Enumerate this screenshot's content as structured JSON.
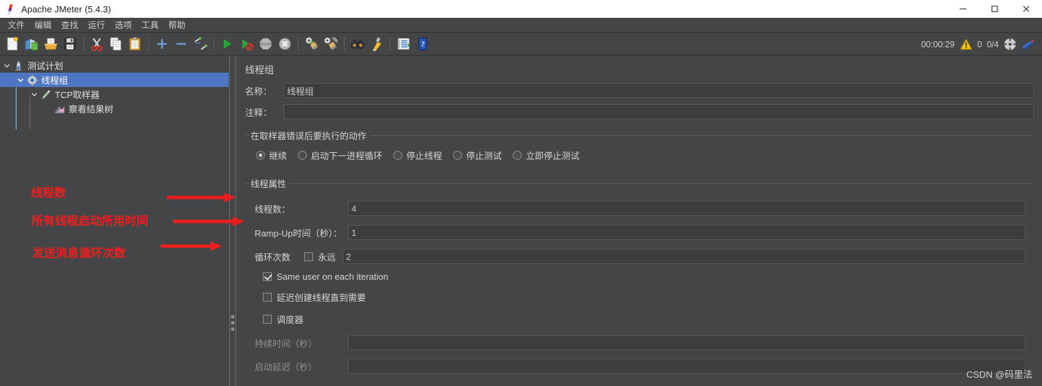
{
  "window": {
    "title": "Apache JMeter (5.4.3)",
    "app_icon": "jmeter-feather-icon",
    "controls": {
      "minimize": "minimize-icon",
      "maximize": "maximize-icon",
      "close": "close-icon"
    }
  },
  "menubar": {
    "items": [
      {
        "label": "文件"
      },
      {
        "label": "编辑"
      },
      {
        "label": "查找"
      },
      {
        "label": "运行"
      },
      {
        "label": "选项"
      },
      {
        "label": "工具"
      },
      {
        "label": "帮助"
      }
    ]
  },
  "toolbar": {
    "buttons": [
      {
        "name": "new-icon"
      },
      {
        "name": "templates-icon"
      },
      {
        "name": "open-icon"
      },
      {
        "name": "save-icon"
      },
      {
        "name": "cut-icon"
      },
      {
        "name": "copy-icon"
      },
      {
        "name": "paste-icon"
      },
      {
        "name": "expand-all-icon"
      },
      {
        "name": "collapse-all-icon"
      },
      {
        "name": "toggle-icon"
      },
      {
        "name": "start-icon"
      },
      {
        "name": "start-no-timers-icon"
      },
      {
        "name": "stop-icon"
      },
      {
        "name": "shutdown-icon"
      },
      {
        "name": "clear-icon"
      },
      {
        "name": "clear-all-icon"
      },
      {
        "name": "search-icon"
      },
      {
        "name": "reset-search-icon"
      },
      {
        "name": "function-helper-icon"
      },
      {
        "name": "help-icon"
      }
    ],
    "status": {
      "elapsed": "00:00:29",
      "warning_icon": "warning-triangle-icon",
      "error_count": "0",
      "threads": "0/4",
      "remote_icon": "remote-toggle-icon",
      "darkmode_icon": "jmeter-bird-icon"
    }
  },
  "tree": {
    "nodes": [
      {
        "label": "测试计划",
        "icon": "test-plan-icon",
        "depth": 0,
        "expanded": true,
        "selected": false
      },
      {
        "label": "线程组",
        "icon": "thread-group-gear-icon",
        "depth": 1,
        "expanded": true,
        "selected": true
      },
      {
        "label": "TCP取样器",
        "icon": "tcp-sampler-pipette-icon",
        "depth": 2,
        "expanded": true,
        "selected": false
      },
      {
        "label": "察看结果树",
        "icon": "view-results-tree-icon",
        "depth": 3,
        "expanded": false,
        "selected": false
      }
    ]
  },
  "detail": {
    "panel_title": "线程组",
    "name": {
      "label": "名称：",
      "value": "线程组"
    },
    "comment": {
      "label": "注释：",
      "value": "",
      "placeholder": ""
    },
    "error_action": {
      "legend": "在取样器错误后要执行的动作",
      "options": [
        {
          "label": "继续",
          "selected": true
        },
        {
          "label": "启动下一进程循环",
          "selected": false
        },
        {
          "label": "停止线程",
          "selected": false
        },
        {
          "label": "停止测试",
          "selected": false
        },
        {
          "label": "立即停止测试",
          "selected": false
        }
      ]
    },
    "thread_properties": {
      "legend": "线程属性",
      "num_threads": {
        "label": "线程数：",
        "value": "4"
      },
      "ramp_up": {
        "label": "Ramp-Up时间（秒）：",
        "value": "1"
      },
      "loop_count": {
        "label": "循环次数",
        "forever_label": "永远",
        "forever_checked": false,
        "value": "2"
      },
      "same_user": {
        "label": "Same user on each iteration",
        "checked": true
      },
      "delay_thread_creation": {
        "label": "延迟创建线程直到需要",
        "checked": false
      },
      "scheduler": {
        "label": "调度器",
        "checked": false
      },
      "duration": {
        "label": "持续时间（秒）",
        "value": "",
        "enabled": false
      },
      "startup_delay": {
        "label": "启动延迟（秒）",
        "value": "",
        "enabled": false
      }
    }
  },
  "annotations": {
    "color": "#f01f1f",
    "items": [
      {
        "text": "线程数"
      },
      {
        "text": "所有线程启动所用时间"
      },
      {
        "text": "发送消息循环次数"
      }
    ]
  },
  "watermark": {
    "text": "CSDN @码里法"
  }
}
